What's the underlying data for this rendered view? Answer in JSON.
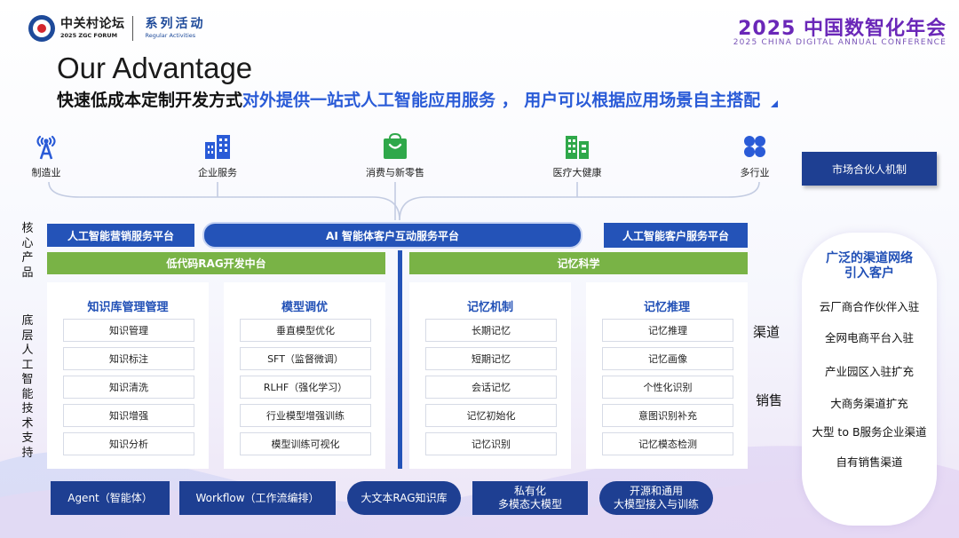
{
  "header": {
    "logo_cn": "中关村论坛",
    "logo_en": "2025 ZGC FORUM",
    "series_cn": "系列活动",
    "series_en": "Regular Activities",
    "event_title": "2025 中国数智化年会",
    "event_subtitle": "2025 CHINA DIGITAL ANNUAL CONFERENCE"
  },
  "heading": "Our Advantage",
  "subheading": {
    "part1": "快速低成本定制开发方式",
    "part2": "对外提供一站式人工智能应用服务 ， 用户可以根据应用场景自主搭配"
  },
  "industries": [
    {
      "label": "制造业",
      "icon": "antenna-icon"
    },
    {
      "label": "企业服务",
      "icon": "buildings-icon"
    },
    {
      "label": "消费与新零售",
      "icon": "shopping-bag-icon"
    },
    {
      "label": "医疗大健康",
      "icon": "hospital-icon"
    },
    {
      "label": "多行业",
      "icon": "four-petal-icon"
    }
  ],
  "partner_button": "市场合伙人机制",
  "left_labels": {
    "core": "核心产品",
    "base": "底层人工智能技术支持"
  },
  "platforms": {
    "left": "人工智能营销服务平台",
    "center": "AI 智能体客户互动服务平台",
    "right": "人工智能客户服务平台"
  },
  "green_bars": {
    "left": "低代码RAG开发中台",
    "right": "记忆科学"
  },
  "modules": [
    {
      "title": "知识库管理管理",
      "items": [
        "知识管理",
        "知识标注",
        "知识清洗",
        "知识增强",
        "知识分析"
      ]
    },
    {
      "title": "模型调优",
      "items": [
        "垂直模型优化",
        "SFT（监督微调）",
        "RLHF（强化学习）",
        "行业模型增强训练",
        "模型训练可视化"
      ]
    },
    {
      "title": "记忆机制",
      "items": [
        "长期记忆",
        "短期记忆",
        "会话记忆",
        "记忆初始化",
        "记忆识别"
      ]
    },
    {
      "title": "记忆推理",
      "items": [
        "记忆推理",
        "记忆画像",
        "个性化识别",
        "意图识别补充",
        "记忆模态检测"
      ]
    }
  ],
  "bottom_buttons": [
    {
      "line1": "Agent（智能体）",
      "line2": ""
    },
    {
      "line1": "Workflow（工作流编排）",
      "line2": ""
    },
    {
      "line1": "大文本RAG知识库",
      "line2": ""
    },
    {
      "line1": "私有化",
      "line2": "多模态大模型"
    },
    {
      "line1": "开源和通用",
      "line2": "大模型接入与训练"
    }
  ],
  "side_words": {
    "channel": "渠道",
    "sales": "销售"
  },
  "channels": {
    "title_line1": "广泛的渠道网络",
    "title_line2": "引入客户",
    "items": [
      "云厂商合作伙伴入驻",
      "全网电商平台入驻",
      "产业园区入驻扩充",
      "大商务渠道扩充",
      "大型 to  B服务企业渠道",
      "自有销售渠道"
    ]
  },
  "colors": {
    "navy": "#1e3f92",
    "platform_blue": "#2453b8",
    "accent_blue": "#2a5bd7",
    "green": "#79b346",
    "purple": "#6a27b8"
  }
}
